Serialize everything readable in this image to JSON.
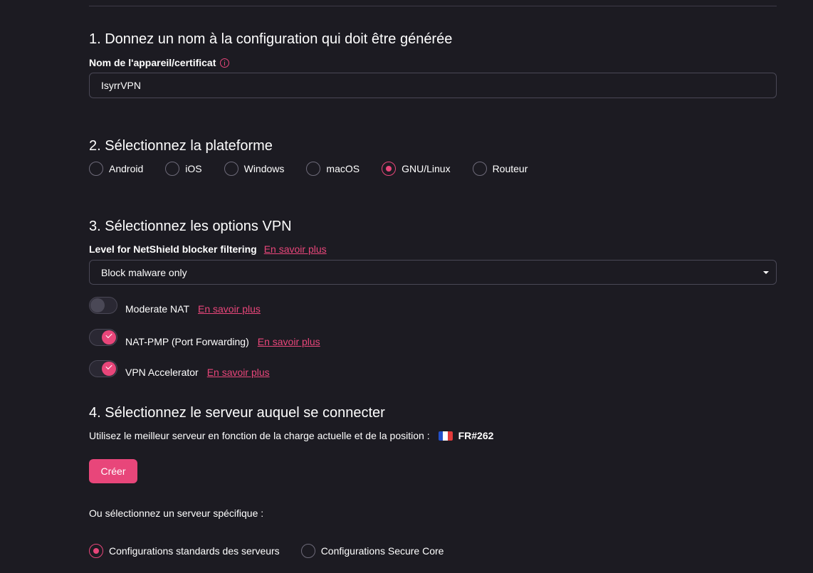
{
  "section1": {
    "title": "1. Donnez un nom à la configuration qui doit être générée",
    "device_label": "Nom de l'appareil/certificat",
    "device_value": "IsyrrVPN"
  },
  "section2": {
    "title": "2. Sélectionnez la plateforme",
    "platforms": [
      {
        "label": "Android",
        "selected": false
      },
      {
        "label": "iOS",
        "selected": false
      },
      {
        "label": "Windows",
        "selected": false
      },
      {
        "label": "macOS",
        "selected": false
      },
      {
        "label": "GNU/Linux",
        "selected": true
      },
      {
        "label": "Routeur",
        "selected": false
      }
    ]
  },
  "section3": {
    "title": "3. Sélectionnez les options VPN",
    "netshield_label": "Level for NetShield blocker filtering",
    "learn_more": "En savoir plus",
    "netshield_value": "Block malware only",
    "toggles": [
      {
        "label": "Moderate NAT",
        "on": false
      },
      {
        "label": "NAT-PMP (Port Forwarding)",
        "on": true
      },
      {
        "label": "VPN Accelerator",
        "on": true
      }
    ]
  },
  "section4": {
    "title": "4. Sélectionnez le serveur auquel se connecter",
    "best_server_text": "Utilisez le meilleur serveur en fonction de la charge actuelle et de la position :",
    "best_server_code": "FR#262",
    "create_label": "Créer",
    "specific_server_text": "Ou sélectionnez un serveur spécifique :",
    "config_options": [
      {
        "label": "Configurations standards des serveurs",
        "selected": true
      },
      {
        "label": "Configurations Secure Core",
        "selected": false
      }
    ]
  },
  "colors": {
    "accent": "#e8467a",
    "background": "#1c1b22",
    "border": "#4a4856"
  },
  "icons": [
    "info-icon",
    "caret-down-icon",
    "check-icon",
    "france-flag-icon"
  ]
}
